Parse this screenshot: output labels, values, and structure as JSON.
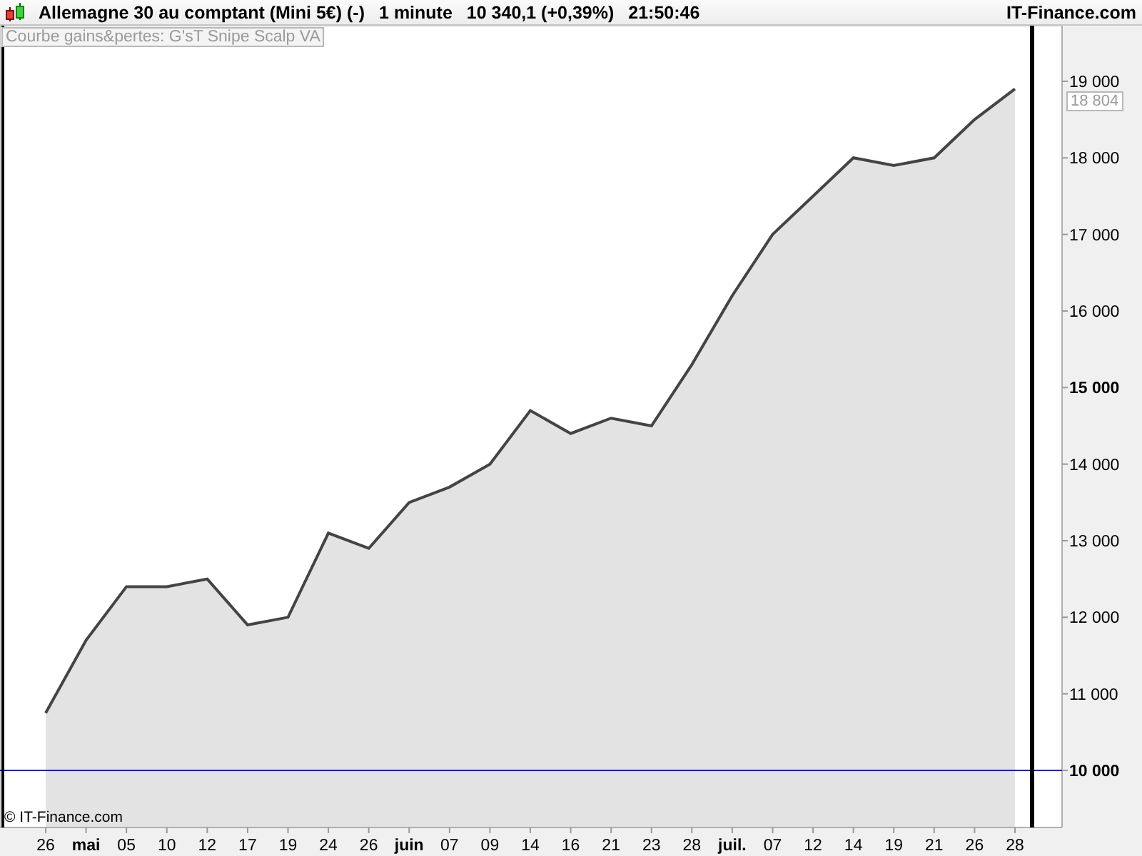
{
  "header": {
    "instrument": "Allemagne 30 au comptant (Mini 5€) (-)",
    "timeframe": "1 minute",
    "quote": "10 340,1 (+0,39%)",
    "time": "21:50:46",
    "brand": "IT-Finance.com"
  },
  "indicator_label": "Courbe gains&pertes: G'sT Snipe Scalp VA",
  "copyright": "© IT-Finance.com",
  "last_value_label": "18 804",
  "chart_data": {
    "type": "area",
    "categories": [
      "26",
      "mai",
      "05",
      "10",
      "12",
      "17",
      "19",
      "24",
      "26",
      "juin",
      "07",
      "09",
      "14",
      "16",
      "21",
      "23",
      "28",
      "juil.",
      "07",
      "12",
      "14",
      "19",
      "21",
      "26",
      "28"
    ],
    "series": [
      {
        "color": "#444444",
        "values": [
          10750,
          11700,
          12400,
          12400,
          12500,
          11900,
          12000,
          13100,
          12900,
          13500,
          13700,
          14000,
          14700,
          14400,
          14600,
          14500,
          15300,
          16200,
          17000,
          17500,
          18000,
          17900,
          18000,
          18500,
          18900
        ]
      }
    ],
    "ylim": [
      9255,
      19726
    ],
    "yticks": [
      {
        "value": 10000,
        "label": "10 000"
      },
      {
        "value": 11000,
        "label": "11 000"
      },
      {
        "value": 12000,
        "label": "12 000"
      },
      {
        "value": 13000,
        "label": "13 000"
      },
      {
        "value": 14000,
        "label": "14 000"
      },
      {
        "value": 15000,
        "label": "15 000"
      },
      {
        "value": 16000,
        "label": "16 000"
      },
      {
        "value": 17000,
        "label": "17 000"
      },
      {
        "value": 18000,
        "label": "18 000"
      },
      {
        "value": 19000,
        "label": "19 000"
      }
    ]
  }
}
